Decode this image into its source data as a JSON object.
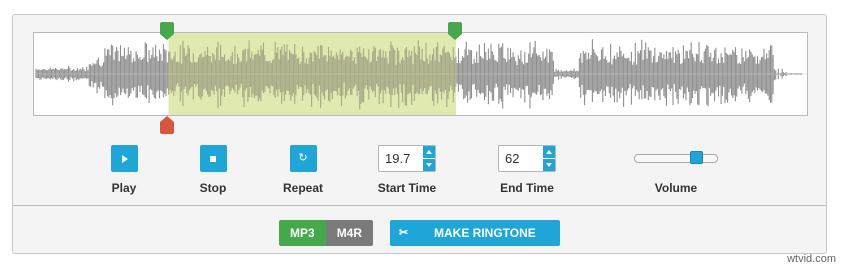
{
  "waveform": {
    "selection_start_fraction": 0.174,
    "selection_end_fraction": 0.546,
    "colors": {
      "wave": "#8e8e8e",
      "selected_overlay": "#dfe9b0",
      "selected_wave": "#a6a886",
      "start_handle": "#45a84a",
      "end_handle": "#45a84a",
      "playhead_handle": "#d9563c"
    }
  },
  "controls": {
    "play": {
      "label": "Play",
      "icon": "play-icon"
    },
    "stop": {
      "label": "Stop",
      "icon": "stop-icon"
    },
    "repeat": {
      "label": "Repeat",
      "icon": "repeat-icon"
    },
    "start_time": {
      "label": "Start Time",
      "value": "19.7"
    },
    "end_time": {
      "label": "End Time",
      "value": "62"
    },
    "volume": {
      "label": "Volume",
      "level": 0.8
    }
  },
  "format": {
    "options": [
      "MP3",
      "M4R"
    ],
    "selected": "MP3"
  },
  "make_ringtone": {
    "label": "MAKE RINGTONE",
    "icon": "scissors-icon"
  },
  "watermark": "wtvid.com",
  "accent_color": "#1fa6d8"
}
